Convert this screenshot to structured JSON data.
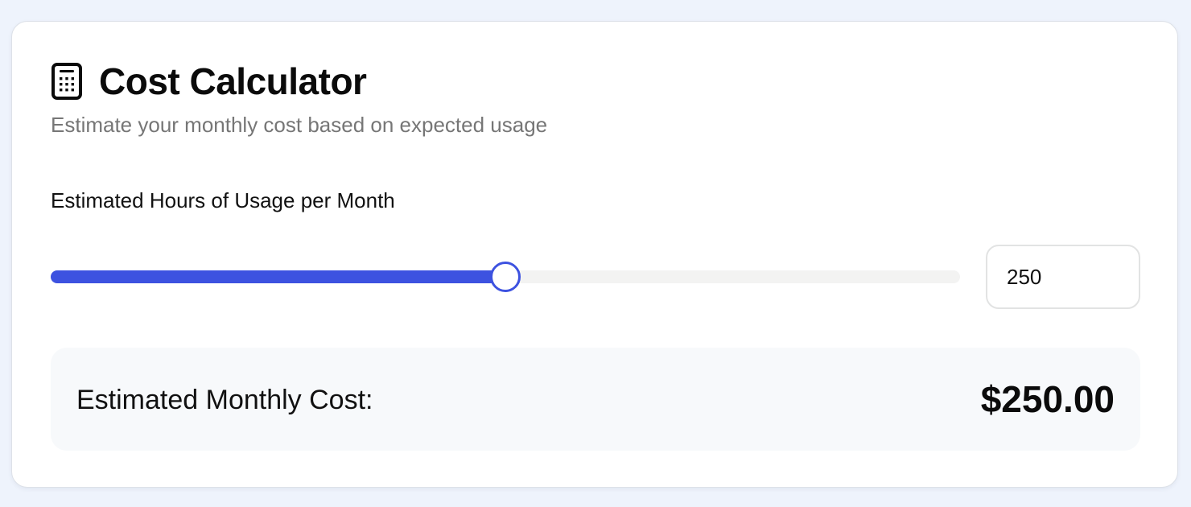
{
  "calculator": {
    "title": "Cost Calculator",
    "subtitle": "Estimate your monthly cost based on expected usage",
    "icon": "calculator-icon",
    "accent_color": "#3d52e0"
  },
  "usage": {
    "label": "Estimated Hours of Usage per Month",
    "value": "250",
    "slider_fraction": 0.5
  },
  "result": {
    "label": "Estimated Monthly Cost:",
    "value": "$250.00"
  }
}
